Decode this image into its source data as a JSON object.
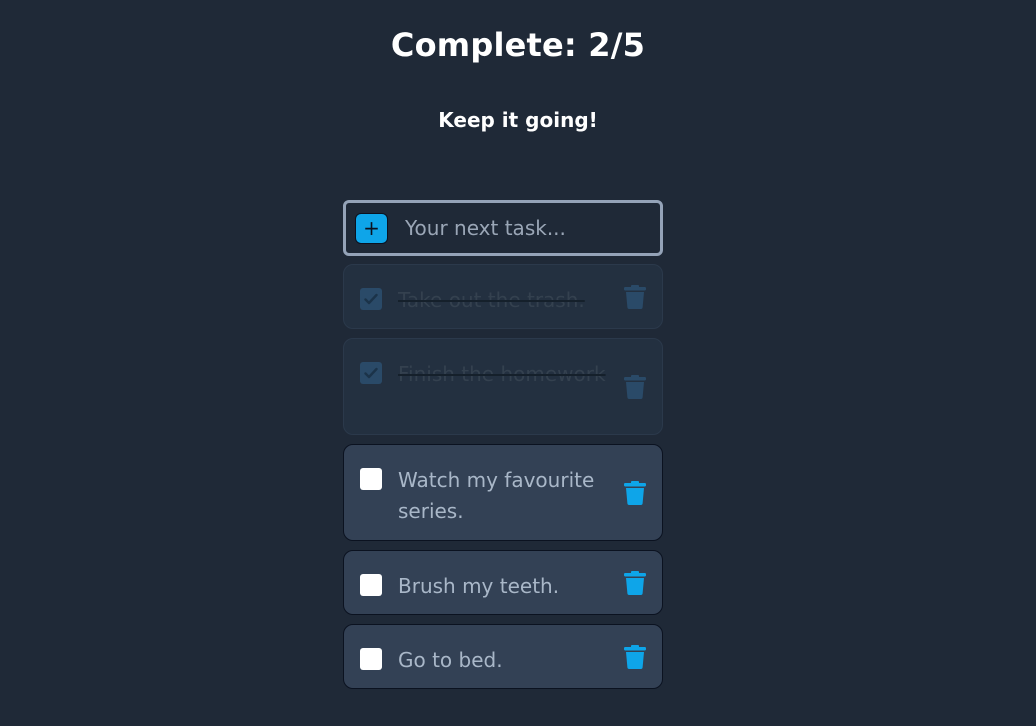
{
  "header": {
    "title": "Complete: 2/5",
    "subtitle": "Keep it going!"
  },
  "new_task": {
    "add_label": "+",
    "placeholder": "Your next task..."
  },
  "tasks": [
    {
      "label": "Take out the trash.",
      "done": true
    },
    {
      "label": "Finish the homework",
      "done": true
    },
    {
      "label": "Watch my favourite series.",
      "done": false
    },
    {
      "label": "Brush my teeth.",
      "done": false
    },
    {
      "label": "Go to bed.",
      "done": false
    }
  ],
  "colors": {
    "background": "#1f2937",
    "accent": "#0ea5e9",
    "task_card": "#334155",
    "done_card": "#233040"
  },
  "icons": {
    "add": "plus-icon",
    "check": "check-icon",
    "delete": "trash-icon"
  }
}
